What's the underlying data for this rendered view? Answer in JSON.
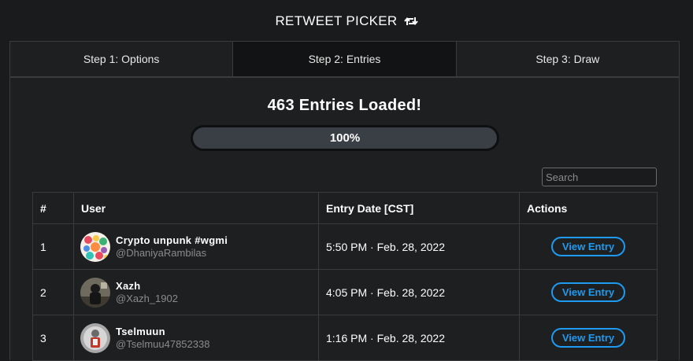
{
  "header": {
    "title": "RETWEET PICKER",
    "icon": "retweet-icon"
  },
  "tabs": [
    {
      "label": "Step 1: Options",
      "active": false
    },
    {
      "label": "Step 2: Entries",
      "active": true
    },
    {
      "label": "Step 3: Draw",
      "active": false
    }
  ],
  "status": {
    "message": "463 Entries Loaded!",
    "progress_label": "100%",
    "progress_value": 1.0
  },
  "search": {
    "placeholder": "Search",
    "value": ""
  },
  "table": {
    "headers": [
      "#",
      "User",
      "Entry Date [CST]",
      "Actions"
    ],
    "rows": [
      {
        "num": "1",
        "name": "Crypto unpunk #wgmi",
        "handle": "@DhaniyaRambilas",
        "date": "5:50 PM · Feb. 28, 2022",
        "action": "View Entry"
      },
      {
        "num": "2",
        "name": "Xazh",
        "handle": "@Xazh_1902",
        "date": "4:05 PM · Feb. 28, 2022",
        "action": "View Entry"
      },
      {
        "num": "3",
        "name": "Tselmuun",
        "handle": "@Tselmuu47852338",
        "date": "1:16 PM · Feb. 28, 2022",
        "action": "View Entry"
      }
    ]
  },
  "colors": {
    "accent": "#1d9bf0",
    "background": "#1a1b1d",
    "panel": "#1e1f21"
  }
}
